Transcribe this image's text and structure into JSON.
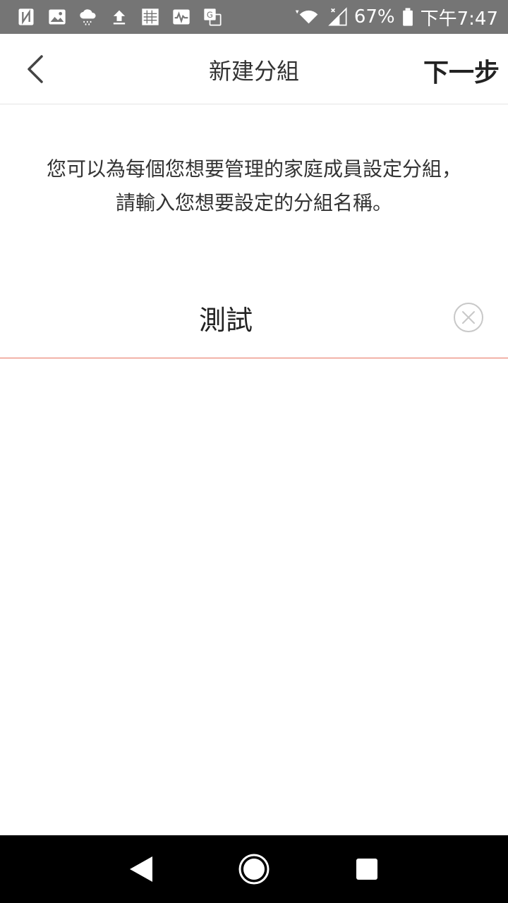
{
  "status_bar": {
    "battery_percent": "67%",
    "time": "下午7:47",
    "icons": [
      "nfc-icon",
      "image-icon",
      "weather-rain-icon",
      "upload-icon",
      "pattern-icon",
      "activity-icon",
      "translate-icon",
      "wifi-icon",
      "signal-icon",
      "battery-icon"
    ]
  },
  "app_bar": {
    "title": "新建分組",
    "next_label": "下一步"
  },
  "instruction": {
    "text": "您可以為每個您想要管理的家庭成員設定分組，請輸入您想要設定的分組名稱。"
  },
  "group_name_input": {
    "value": "測試",
    "placeholder": ""
  },
  "colors": {
    "status_bar_bg": "#757575",
    "input_underline": "#e7715f",
    "nav_bar_bg": "#000000"
  }
}
